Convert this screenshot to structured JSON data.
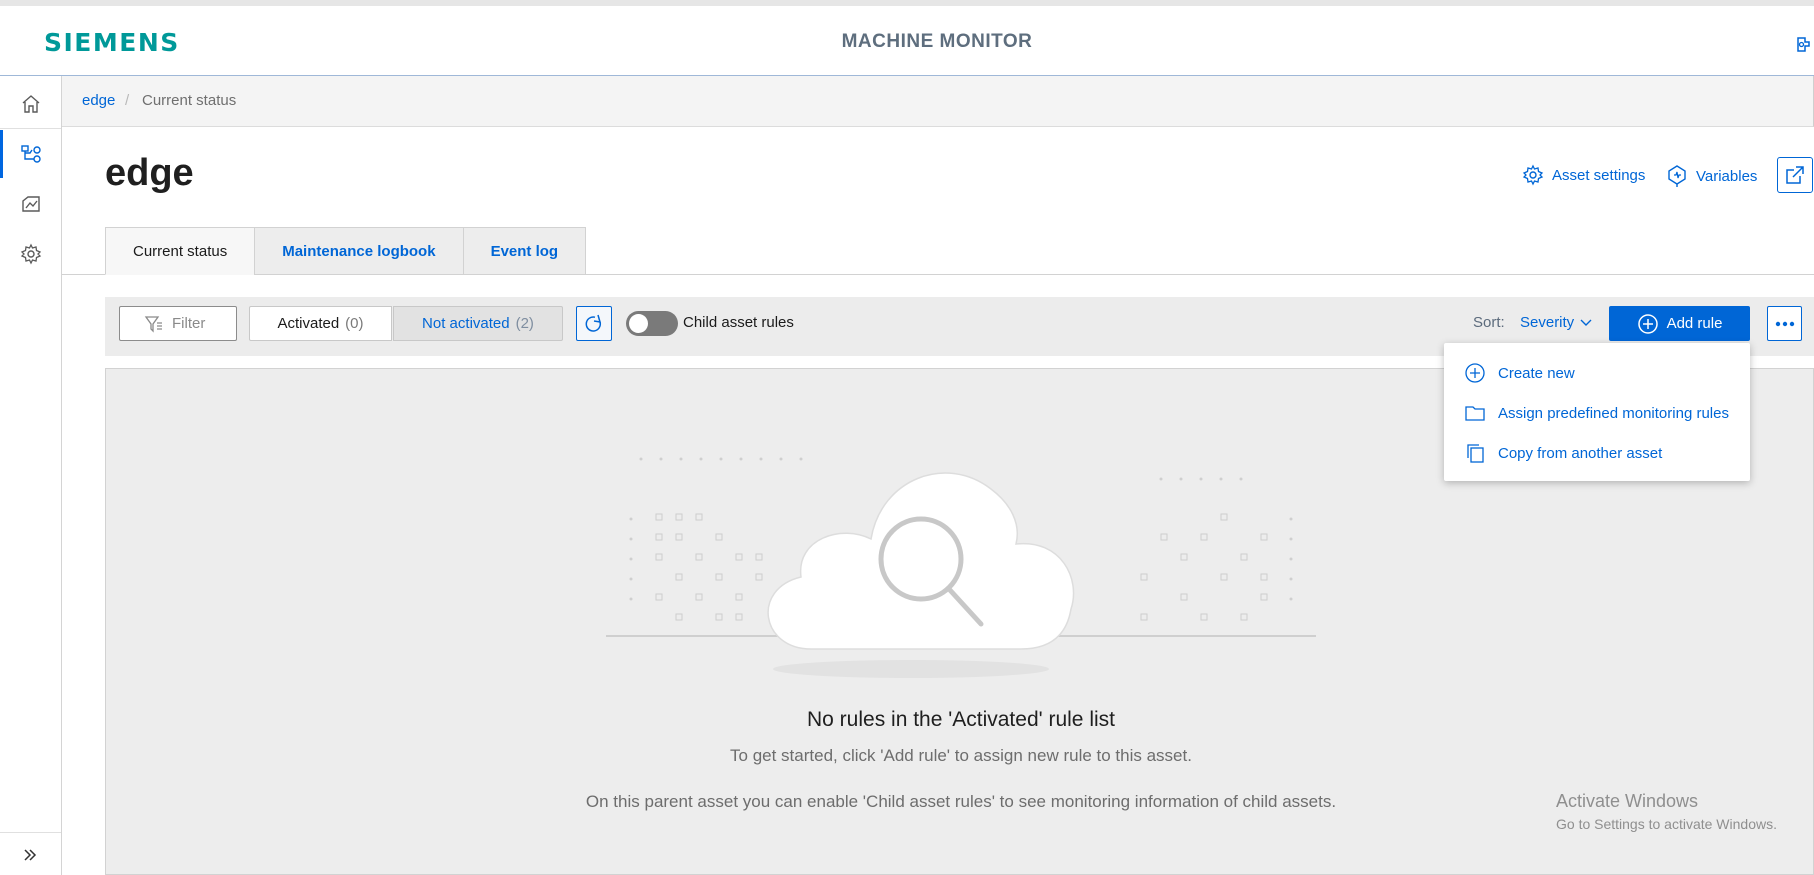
{
  "header": {
    "logo": "SIEMENS",
    "title": "MACHINE MONITOR",
    "user_icon": "user-settings-icon"
  },
  "sidebar": {
    "items": [
      {
        "name": "home",
        "icon": "home-icon"
      },
      {
        "name": "asset-hierarchy",
        "icon": "hierarchy-icon",
        "active": true
      },
      {
        "name": "analytics",
        "icon": "chart-icon"
      },
      {
        "name": "settings",
        "icon": "gear-icon"
      }
    ],
    "expand_icon": "double-chevron-right-icon"
  },
  "breadcrumb": {
    "link": "edge",
    "separator": "/",
    "current": "Current status"
  },
  "page": {
    "title": "edge",
    "asset_settings_label": "Asset settings",
    "variables_label": "Variables"
  },
  "tabs": [
    {
      "label": "Current status",
      "active": true
    },
    {
      "label": "Maintenance logbook",
      "active": false
    },
    {
      "label": "Event log",
      "active": false
    }
  ],
  "toolbar": {
    "filter_placeholder": "Filter",
    "activated_label": "Activated",
    "activated_count": "(0)",
    "not_activated_label": "Not activated",
    "not_activated_count": "(2)",
    "child_rules_label": "Child asset rules",
    "child_rules_enabled": false,
    "sort_label": "Sort:",
    "sort_value": "Severity",
    "add_rule_label": "Add rule"
  },
  "menu": {
    "items": [
      {
        "label": "Create new",
        "icon": "plus-circle-icon"
      },
      {
        "label": "Assign predefined monitoring rules",
        "icon": "folder-icon"
      },
      {
        "label": "Copy from another asset",
        "icon": "copy-icon"
      }
    ]
  },
  "empty_state": {
    "title": "No rules in the 'Activated' rule list",
    "subtitle": "To get started, click 'Add rule' to assign new rule to this asset.",
    "hint": "On this parent asset you can enable 'Child asset rules' to see monitoring information of child assets."
  },
  "watermark": {
    "title": "Activate Windows",
    "subtitle": "Go to Settings to activate Windows."
  },
  "colors": {
    "accent": "#0066d6",
    "brand": "#009999",
    "toolbar_bg": "#ececec"
  }
}
